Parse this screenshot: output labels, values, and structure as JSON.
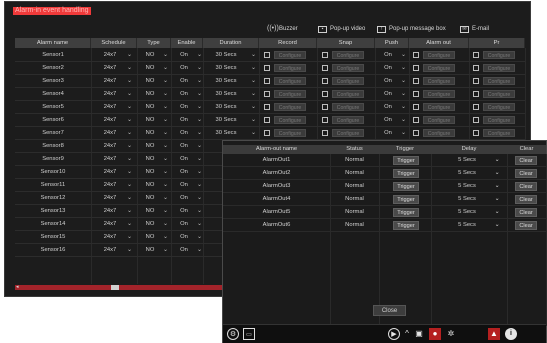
{
  "title": "Alarm-in event handling",
  "toolbar": {
    "buzzer": "Buzzer",
    "popup_video": "Pop-up video",
    "popup_msg": "Pop-up message box",
    "email": "E-mail"
  },
  "headers": [
    "Alarm name",
    "Schedule",
    "Type",
    "Enable",
    "Duration",
    "Record",
    "Snap",
    "Push",
    "Alarm out",
    "Pr"
  ],
  "configure_label": "Configure",
  "rows": [
    {
      "name": "Sensor1",
      "schedule": "24x7",
      "type": "NO",
      "enable": "On",
      "duration": "30 Secs",
      "push": "On"
    },
    {
      "name": "Sensor2",
      "schedule": "24x7",
      "type": "NO",
      "enable": "On",
      "duration": "30 Secs",
      "push": "On"
    },
    {
      "name": "Sensor3",
      "schedule": "24x7",
      "type": "NO",
      "enable": "On",
      "duration": "30 Secs",
      "push": "On"
    },
    {
      "name": "Sensor4",
      "schedule": "24x7",
      "type": "NO",
      "enable": "On",
      "duration": "30 Secs",
      "push": "On"
    },
    {
      "name": "Sensor5",
      "schedule": "24x7",
      "type": "NO",
      "enable": "On",
      "duration": "30 Secs",
      "push": "On"
    },
    {
      "name": "Sensor6",
      "schedule": "24x7",
      "type": "NO",
      "enable": "On",
      "duration": "30 Secs",
      "push": "On"
    },
    {
      "name": "Sensor7",
      "schedule": "24x7",
      "type": "NO",
      "enable": "On",
      "duration": "30 Secs",
      "push": "On"
    },
    {
      "name": "Sensor8",
      "schedule": "24x7",
      "type": "NO",
      "enable": "On",
      "duration": "",
      "push": ""
    },
    {
      "name": "Sensor9",
      "schedule": "24x7",
      "type": "NO",
      "enable": "On",
      "duration": "",
      "push": ""
    },
    {
      "name": "Sensor10",
      "schedule": "24x7",
      "type": "NO",
      "enable": "On",
      "duration": "",
      "push": ""
    },
    {
      "name": "Sensor11",
      "schedule": "24x7",
      "type": "NO",
      "enable": "On",
      "duration": "",
      "push": ""
    },
    {
      "name": "Sensor12",
      "schedule": "24x7",
      "type": "NO",
      "enable": "On",
      "duration": "",
      "push": ""
    },
    {
      "name": "Sensor13",
      "schedule": "24x7",
      "type": "NO",
      "enable": "On",
      "duration": "",
      "push": ""
    },
    {
      "name": "Sensor14",
      "schedule": "24x7",
      "type": "NO",
      "enable": "On",
      "duration": "",
      "push": ""
    },
    {
      "name": "Sensor15",
      "schedule": "24x7",
      "type": "NO",
      "enable": "On",
      "duration": "",
      "push": ""
    },
    {
      "name": "Sensor16",
      "schedule": "24x7",
      "type": "NO",
      "enable": "On",
      "duration": "",
      "push": ""
    }
  ],
  "popup": {
    "headers": [
      "Alarm-out name",
      "Status",
      "Trigger",
      "Delay",
      "Clear"
    ],
    "rows": [
      {
        "name": "AlarmOut1",
        "status": "Normal",
        "trigger": "Trigger",
        "delay": "5 Secs",
        "clear": "Clear"
      },
      {
        "name": "AlarmOut2",
        "status": "Normal",
        "trigger": "Trigger",
        "delay": "5 Secs",
        "clear": "Clear"
      },
      {
        "name": "AlarmOut3",
        "status": "Normal",
        "trigger": "Trigger",
        "delay": "5 Secs",
        "clear": "Clear"
      },
      {
        "name": "AlarmOut4",
        "status": "Normal",
        "trigger": "Trigger",
        "delay": "5 Secs",
        "clear": "Clear"
      },
      {
        "name": "AlarmOut5",
        "status": "Normal",
        "trigger": "Trigger",
        "delay": "5 Secs",
        "clear": "Clear"
      },
      {
        "name": "AlarmOut6",
        "status": "Normal",
        "trigger": "Trigger",
        "delay": "5 Secs",
        "clear": "Clear"
      }
    ],
    "close_label": "Close"
  },
  "colors": {
    "accent": "#e0262a",
    "panel": "#1c1c1c",
    "header": "#3f3f3f"
  },
  "icons": [
    "speaker-icon",
    "popup-video-icon",
    "message-box-icon",
    "email-icon",
    "settings-icon",
    "monitor-icon",
    "play-icon",
    "chevron-up-icon",
    "record-icon",
    "user-alert-icon",
    "film-icon",
    "alarm-icon",
    "info-icon"
  ]
}
